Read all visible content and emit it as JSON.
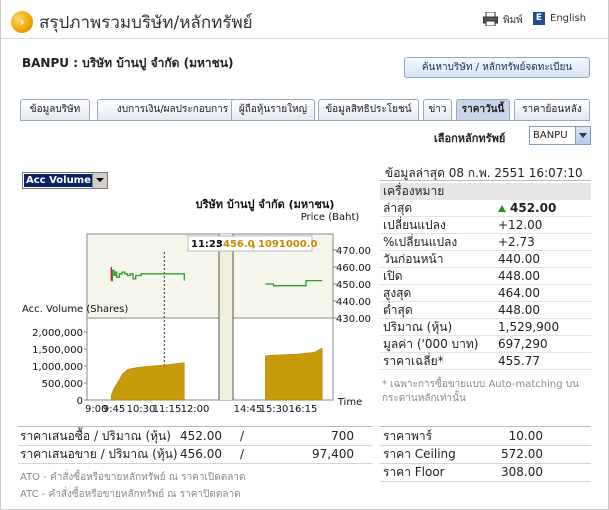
{
  "header": {
    "title": "สรุปภาพรวมบริษัท/หลักทรัพย์",
    "print_label": "พิมพ์",
    "english_label": "English",
    "icons": [
      "arrow-right-icon",
      "printer-icon",
      "english-e-icon"
    ]
  },
  "company": {
    "title": "BANPU : บริษัท บ้านปู จำกัด (มหาชน)",
    "search_button": "ค้นหาบริษัท / หลักทรัพย์จดทะเบียน"
  },
  "tabs": [
    {
      "label": "ข้อมูลบริษัท"
    },
    {
      "label": "งบการเงิน/ผลประกอบการ"
    },
    {
      "label": "ผู้ถือหุ้นรายใหญ่"
    },
    {
      "label": "ข้อมูลสิทธิประโยชน์"
    },
    {
      "label": "ข่าว"
    },
    {
      "label": "ราคาวันนี้"
    },
    {
      "label": "ราคาย้อนหลัง"
    }
  ],
  "selector": {
    "label": "เลือกหลักทรัพย์",
    "value": "BANPU"
  },
  "chart": {
    "dropdown_value": "Acc Volume"
  },
  "chart_data": {
    "type": "line",
    "title": "บริษัท บ้านปู จำกัด (มหาชน)",
    "price_axis_label": "Price (Baht)",
    "volume_axis_label": "Acc. Volume (Shares)",
    "xlabel": "Time",
    "price_ticks": [
      "470.00",
      "460.00",
      "450.00",
      "440.00",
      "430.00"
    ],
    "price_ylim": [
      430,
      470
    ],
    "volume_ticks": [
      "2,000,000",
      "1,500,000",
      "1,000,000",
      "500,000",
      "0"
    ],
    "volume_ylim": [
      0,
      2000000
    ],
    "x_tick_labels": [
      "9:00",
      "9:45",
      "10:30",
      "11:15",
      "12:00",
      "14:45",
      "15:30",
      "16:15"
    ],
    "tooltip": {
      "time": "11:23",
      "price": "456.0",
      "volume": "1091000.0"
    },
    "series": [
      {
        "name": "Price",
        "color": "#2a9a2a",
        "x": [
          "9:45",
          "9:47",
          "9:50",
          "9:52",
          "9:55",
          "10:00",
          "10:05",
          "10:10",
          "10:15",
          "10:20",
          "10:25",
          "10:30",
          "10:40",
          "10:50",
          "11:00",
          "11:15",
          "11:30",
          "12:00",
          "14:30",
          "14:45",
          "15:00",
          "15:15",
          "15:30",
          "15:45",
          "16:00",
          "16:15"
        ],
        "values": [
          452,
          458,
          455,
          457,
          454,
          456,
          457,
          456,
          455,
          456,
          453,
          455,
          456,
          456,
          456,
          456,
          456,
          452,
          450,
          449,
          449,
          449,
          449,
          452,
          452,
          452
        ]
      },
      {
        "name": "Acc. Volume",
        "color": "#c79a0a",
        "x": [
          "9:45",
          "9:50",
          "9:55",
          "10:00",
          "10:05",
          "10:15",
          "10:30",
          "10:45",
          "11:00",
          "11:15",
          "11:30",
          "12:00",
          "14:30",
          "14:45",
          "15:00",
          "15:15",
          "15:30",
          "15:45",
          "16:00",
          "16:15"
        ],
        "values": [
          150000,
          350000,
          480000,
          600000,
          760000,
          900000,
          950000,
          980000,
          1000000,
          1020000,
          1040000,
          1100000,
          1300000,
          1320000,
          1330000,
          1340000,
          1350000,
          1380000,
          1400000,
          1530000
        ]
      }
    ]
  },
  "info": {
    "last_update": "ข้อมูลล่าสุด 08 ก.พ. 2551 16:07:10",
    "header_row": "เครื่องหมาย",
    "rows": [
      {
        "label": "ล่าสุด",
        "value": "452.00",
        "style": "up-bold"
      },
      {
        "label": "เปลี่ยนแปลง",
        "value": "+12.00",
        "style": "up"
      },
      {
        "label": "%เปลี่ยนแปลง",
        "value": "+2.73",
        "style": "up"
      },
      {
        "label": "วันก่อนหน้า",
        "value": "440.00",
        "style": ""
      },
      {
        "label": "เปิด",
        "value": "448.00",
        "style": ""
      },
      {
        "label": "สูงสุด",
        "value": "464.00",
        "style": ""
      },
      {
        "label": "ต่ำสุด",
        "value": "448.00",
        "style": ""
      },
      {
        "label": "ปริมาณ (หุ้น)",
        "value": "1,529,900",
        "style": ""
      },
      {
        "label": "มูลค่า ('000 บาท)",
        "value": "697,290",
        "style": ""
      },
      {
        "label": "ราคาเฉลี่ย*",
        "value": "455.77",
        "style": ""
      }
    ],
    "note": "* เฉพาะการซื้อขายแบบ Auto-matching บนกระดานหลักเท่านั้น"
  },
  "bids": [
    {
      "label": "ราคาเสนอซื้อ / ปริมาณ (หุ้น)",
      "price": "452.00",
      "volume": "700"
    },
    {
      "label": "ราคาเสนอขาย / ปริมาณ (หุ้น)",
      "price": "456.00",
      "volume": "97,400"
    }
  ],
  "limits": [
    {
      "label": "ราคาพาร์",
      "value": "10.00"
    },
    {
      "label": "ราคา Ceiling",
      "value": "572.00"
    },
    {
      "label": "ราคา Floor",
      "value": "308.00"
    }
  ],
  "footnotes": [
    "ATO - คำสั่งซื้อหรือขายหลักทรัพย์ ณ ราคาเปิดตลาด",
    "ATC - คำสั่งซื้อหรือขายหลักทรัพย์ ณ ราคาปิดตลาด"
  ],
  "colors": {
    "up": "#1a9b1a",
    "volume_fill": "#c79a0a",
    "price_line": "#2a9a2a",
    "tab_active": "#c9d6ea"
  }
}
